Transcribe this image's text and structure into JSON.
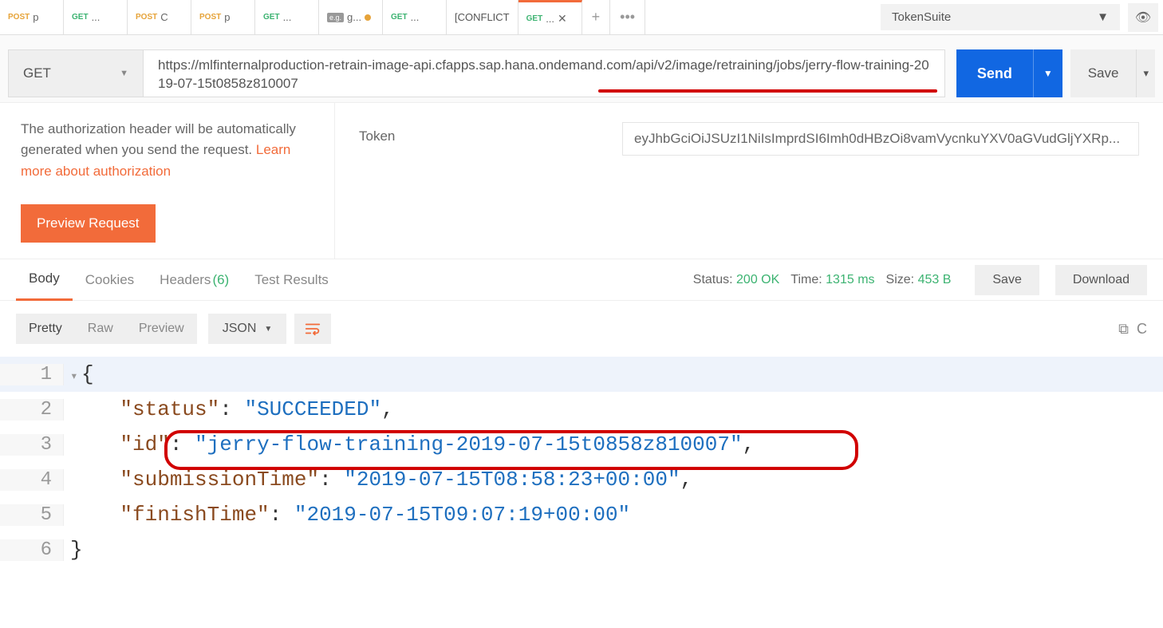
{
  "tabs": [
    {
      "method": "POST",
      "label": "p"
    },
    {
      "method": "GET",
      "label": "..."
    },
    {
      "method": "POST",
      "label": "C"
    },
    {
      "method": "POST",
      "label": "p"
    },
    {
      "method": "GET",
      "label": "..."
    },
    {
      "eg": true,
      "label": "g..."
    },
    {
      "method": "GET",
      "label": "..."
    },
    {
      "plain": "[CONFLICT"
    },
    {
      "method": "GET",
      "label": "...",
      "active": true
    }
  ],
  "env": {
    "name": "TokenSuite"
  },
  "request": {
    "method": "GET",
    "url": "https://mlfinternalproduction-retrain-image-api.cfapps.sap.hana.ondemand.com/api/v2/image/retraining/jobs/jerry-flow-training-2019-07-15t0858z810007",
    "send": "Send",
    "save": "Save"
  },
  "auth": {
    "text1": "The authorization header will be automatically generated when you send the request. ",
    "link": "Learn more about authorization",
    "preview": "Preview Request"
  },
  "token": {
    "label": "Token",
    "value": "eyJhbGciOiJSUzI1NiIsImprdSI6Imh0dHBzOi8vamVycnkuYXV0aGVudGljYXRp..."
  },
  "responseTabs": {
    "body": "Body",
    "cookies": "Cookies",
    "headers": "Headers",
    "headersCount": "(6)",
    "test": "Test Results"
  },
  "status": {
    "label": "Status:",
    "code": "200 OK",
    "timeLabel": "Time:",
    "time": "1315 ms",
    "sizeLabel": "Size:",
    "size": "453 B",
    "save": "Save",
    "download": "Download"
  },
  "formats": {
    "pretty": "Pretty",
    "raw": "Raw",
    "preview": "Preview",
    "json": "JSON"
  },
  "body": {
    "line1": "{",
    "l2k": "\"status\"",
    "l2c": ": ",
    "l2v": "\"SUCCEEDED\"",
    "l2p": ",",
    "l3k": "\"id\"",
    "l3c": ": ",
    "l3v": "\"jerry-flow-training-2019-07-15t0858z810007\"",
    "l3p": ",",
    "l4k": "\"submissionTime\"",
    "l4c": ": ",
    "l4v": "\"2019-07-15T08:58:23+00:00\"",
    "l4p": ",",
    "l5k": "\"finishTime\"",
    "l5c": ": ",
    "l5v": "\"2019-07-15T09:07:19+00:00\"",
    "line6": "}"
  },
  "ln": {
    "1": "1",
    "2": "2",
    "3": "3",
    "4": "4",
    "5": "5",
    "6": "6"
  }
}
